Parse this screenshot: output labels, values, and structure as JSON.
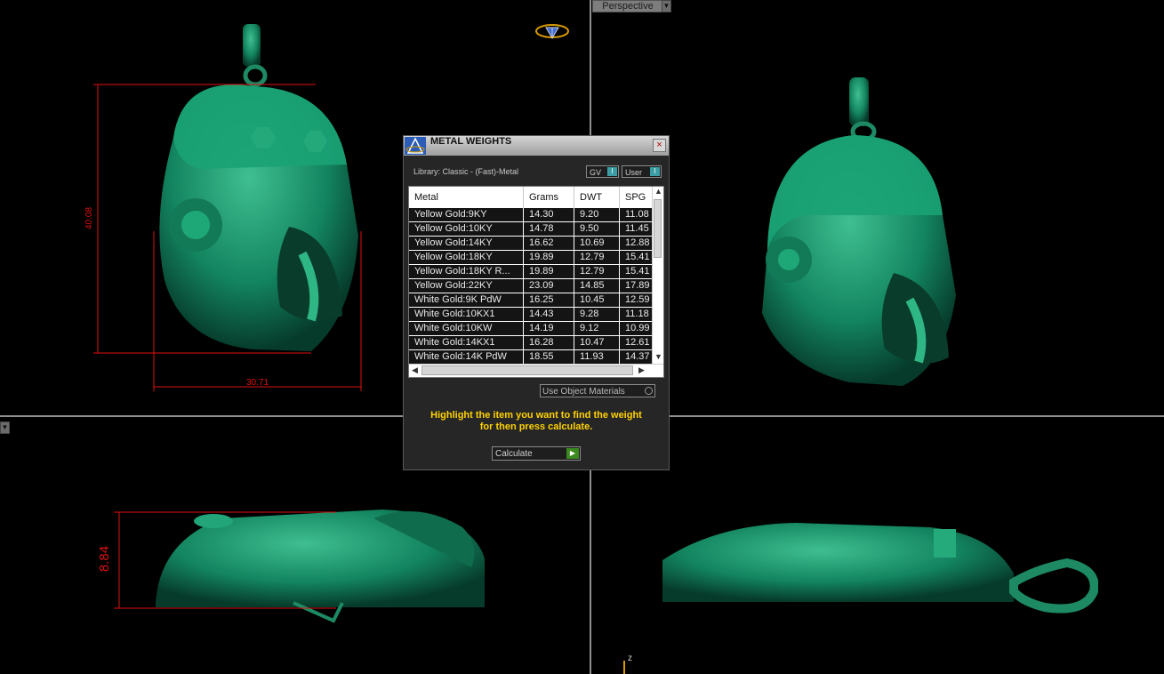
{
  "viewport": {
    "label": "Perspective",
    "axis_label": "z",
    "dimensions": {
      "height_front": "40.08",
      "width_front": "30.71",
      "depth_side": "8.84"
    }
  },
  "dialog": {
    "title": "METAL WEIGHTS",
    "close": "×",
    "library": "Library: Classic - (Fast)-Metal",
    "toggles": [
      {
        "label": "GV",
        "knob": "I"
      },
      {
        "label": "User",
        "knob": "I"
      }
    ],
    "columns": [
      "Metal",
      "Grams",
      "DWT",
      "SPG"
    ],
    "rows": [
      [
        "Yellow Gold:9KY",
        "14.30",
        "9.20",
        "11.08"
      ],
      [
        "Yellow Gold:10KY",
        "14.78",
        "9.50",
        "11.45"
      ],
      [
        "Yellow Gold:14KY",
        "16.62",
        "10.69",
        "12.88"
      ],
      [
        "Yellow Gold:18KY",
        "19.89",
        "12.79",
        "15.41"
      ],
      [
        "Yellow Gold:18KY R...",
        "19.89",
        "12.79",
        "15.41"
      ],
      [
        "Yellow Gold:22KY",
        "23.09",
        "14.85",
        "17.89"
      ],
      [
        "White Gold:9K PdW",
        "16.25",
        "10.45",
        "12.59"
      ],
      [
        "White Gold:10KX1",
        "14.43",
        "9.28",
        "11.18"
      ],
      [
        "White Gold:10KW",
        "14.19",
        "9.12",
        "10.99"
      ],
      [
        "White Gold:14KX1",
        "16.28",
        "10.47",
        "12.61"
      ],
      [
        "White Gold:14K PdW",
        "18.55",
        "11.93",
        "14.37"
      ]
    ],
    "use_object_materials": "Use Object Materials",
    "hint_line1": "Highlight the item you want to find the weight",
    "hint_line2": "for then press calculate.",
    "calculate": "Calculate"
  },
  "colors": {
    "model": "#1f8a66",
    "dimension": "#e01010",
    "hint": "#ffd200"
  }
}
